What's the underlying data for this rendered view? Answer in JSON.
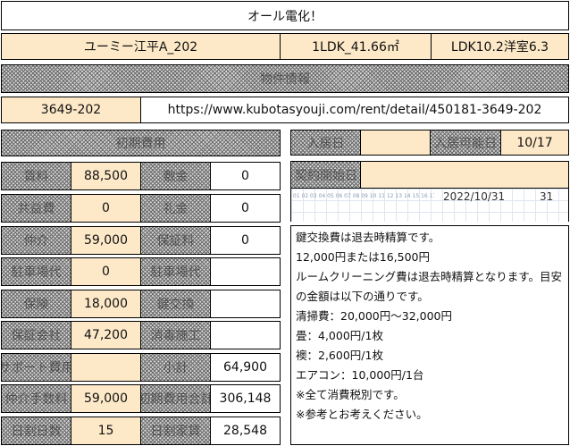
{
  "header": {
    "title": "オール電化！"
  },
  "property": {
    "name": "ユーミー江平A_202",
    "size": "1LDK_41.66㎡",
    "layout": "LDK10.2洋室6.3"
  },
  "section_band": {
    "label": "物件情報"
  },
  "listing": {
    "code": "3649-202",
    "url": "https://www.kubotasyouji.com/rent/detail/450181-3649-202"
  },
  "costs": {
    "header": "初期費用",
    "rows": [
      {
        "label1": "賃料",
        "value1": "88,500",
        "label2": "敷金",
        "value2": "0"
      },
      {
        "label1": "共益費",
        "value1": "0",
        "label2": "礼金",
        "value2": "0"
      },
      {
        "label1": "仲介",
        "value1": "59,000",
        "label2": "保証料",
        "value2": "0"
      },
      {
        "label1": "駐車場代",
        "value1": "0",
        "label2": "駐車場代",
        "value2": ""
      },
      {
        "label1": "保険",
        "value1": "18,000",
        "label2": "鍵交換",
        "value2": ""
      },
      {
        "label1": "保証会社",
        "value1": "47,200",
        "label2": "消毒施工",
        "value2": ""
      },
      {
        "label1": "サポート費用",
        "value1": "",
        "label2": "小計",
        "value2": "64,900"
      },
      {
        "label1": "仲介手数料",
        "value1": "59,000",
        "label2": "初期費用合計",
        "value2": "306,148"
      },
      {
        "label1": "日割日数",
        "value1": "15",
        "label2": "日割家賃",
        "value2": "28,548"
      }
    ]
  },
  "dates": {
    "move_in_label": "入居日",
    "move_in_value": "",
    "contract_label": "入居可能日",
    "contract_value": "10/17",
    "start_label": "契約開始日",
    "start_value": ""
  },
  "calendar": {
    "date": "2022/10/31",
    "days": "31"
  },
  "notes": [
    "鍵交換費は退去時精算です。",
    "12,000円または16,500円",
    "ルームクリーニング費は退去時精算となります。目安の金額は以下の通りです。",
    "清掃費：20,000円～32,000円",
    "畳：4,000円/1枚",
    "襖：2,600円/1枚",
    "エアコン：10,000円/1台",
    "※全て消費税別です。",
    "※参考とお考えください。"
  ]
}
